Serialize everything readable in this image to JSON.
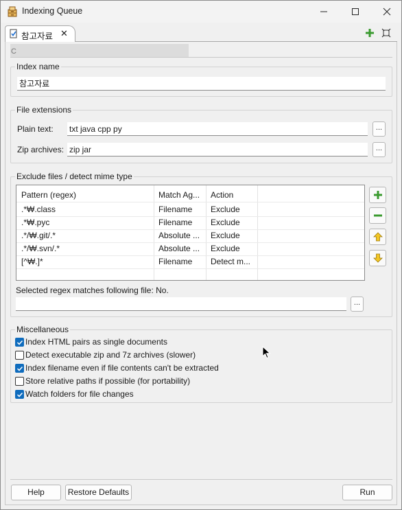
{
  "window": {
    "title": "Indexing Queue"
  },
  "tab": {
    "label": "참고자료",
    "close_glyph": "✕"
  },
  "path": {
    "text": "C"
  },
  "index_name": {
    "group_label": "Index name",
    "value": "참고자료"
  },
  "file_extensions": {
    "group_label": "File extensions",
    "plain_text_label": "Plain text:",
    "plain_text_value": "txt java cpp py",
    "zip_label": "Zip archives:",
    "zip_value": "zip jar",
    "browse_label": "..."
  },
  "exclude": {
    "group_label": "Exclude files / detect mime type",
    "columns": [
      "Pattern (regex)",
      "Match Ag...",
      "Action"
    ],
    "rows": [
      {
        "pattern": ".*₩.class",
        "match": "Filename",
        "action": "Exclude"
      },
      {
        "pattern": ".*₩.pyc",
        "match": "Filename",
        "action": "Exclude"
      },
      {
        "pattern": ".*/₩.git/.*",
        "match": "Absolute ...",
        "action": "Exclude"
      },
      {
        "pattern": ".*/₩.svn/.*",
        "match": "Absolute ...",
        "action": "Exclude"
      },
      {
        "pattern": "[^₩.]*",
        "match": "Filename",
        "action": "Detect m..."
      }
    ],
    "regex_match_label": "Selected regex matches following file: No.",
    "regex_file_value": "",
    "browse_label": "..."
  },
  "misc": {
    "group_label": "Miscellaneous",
    "options": [
      {
        "label": "Index HTML pairs as single documents",
        "checked": true
      },
      {
        "label": "Detect executable zip and 7z archives (slower)",
        "checked": false
      },
      {
        "label": "Index filename even if file contents can't be extracted",
        "checked": true
      },
      {
        "label": "Store relative paths if possible (for portability)",
        "checked": false
      },
      {
        "label": "Watch folders for file changes",
        "checked": true
      }
    ]
  },
  "buttons": {
    "help": "Help",
    "restore": "Restore Defaults",
    "run": "Run"
  },
  "colors": {
    "accent": "#0f6cbd",
    "add_green": "#3a9a2f",
    "remove_green": "#3a9a2f",
    "arrow_yellow": "#f3c623"
  },
  "icons": {
    "app": "cabinet-icon",
    "tab": "index-doc-icon",
    "add": "plus-icon",
    "maximize": "maximize-view-icon",
    "remove": "minus-icon",
    "up": "arrow-up-icon",
    "down": "arrow-down-icon"
  }
}
